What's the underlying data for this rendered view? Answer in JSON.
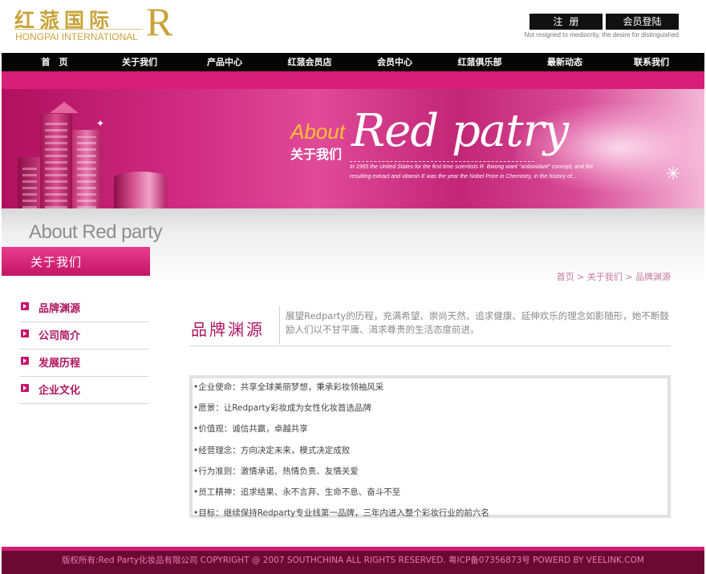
{
  "header": {
    "logo_cn": "红蒎国际",
    "logo_en": "HONGPAI INTERNATIONAL",
    "logo_mark": "R",
    "register_label": "注册",
    "login_label": "会员登陆",
    "slogan": "Not resigned to mediocrity, the desire for distinguished"
  },
  "nav": {
    "items": [
      {
        "label": "首　页"
      },
      {
        "label": "关于我们"
      },
      {
        "label": "产品中心"
      },
      {
        "label": "红蒎会员店"
      },
      {
        "label": "会员中心"
      },
      {
        "label": "红蒎俱乐部"
      },
      {
        "label": "最新动态"
      },
      {
        "label": "联系我们"
      }
    ]
  },
  "banner": {
    "about_en": "About",
    "about_cn": "关于我们",
    "script_text": "Red patry",
    "description": "In 1965 the United States for the first time scientists R. Bwong want \"antioxidant\" concept, and the resulting extract and vitamin E was the year the Nobel Prize in Chemistry, in the history of..."
  },
  "page_header": {
    "title_en": "About Red party",
    "title_cn": "关于我们",
    "breadcrumb": "首页 > 关于我们 > 品牌渊源"
  },
  "sidebar": {
    "items": [
      {
        "label": "品牌渊源"
      },
      {
        "label": "公司简介"
      },
      {
        "label": "发展历程"
      },
      {
        "label": "企业文化"
      }
    ]
  },
  "brand": {
    "title": "品牌渊源",
    "description": "展望Redparty的历程，充满希望、崇尚天然、追求健康、延伸欢乐的理念如影随形，她不断鼓励人们以不甘平庸、渴求尊贵的生活态度前进。"
  },
  "values_list": [
    "•企业使命：共享全球美丽梦想，秉承彩妆领袖风采",
    "•愿景：让Redparty彩妆成为女性化妆首选品牌",
    "•价值观：诚信共赢，卓越共享",
    "•经营理念：方向决定未来，模式决定成败",
    "•行为准则：激情承诺、热情负责、友情关爱",
    "•员工精神：追求结果、永不言弃、生命不息、奋斗不至",
    "•目标：继续保持Redparty专业线第一品牌，三年内进入整个彩妆行业的前六名"
  ],
  "footer": {
    "text": "版权所有:Red Party化妆品有限公司 COPYRIGHT @ 2007 SOUTHCHINA ALL RIGHTS RESERVED. 粤ICP备07356873号 POWERD BY VEELINK.COM"
  },
  "colors": {
    "brand_pink": "#c4166a",
    "gold": "#c9a339",
    "footer_bg": "#6a0a33",
    "nav_bg": "#050505"
  }
}
